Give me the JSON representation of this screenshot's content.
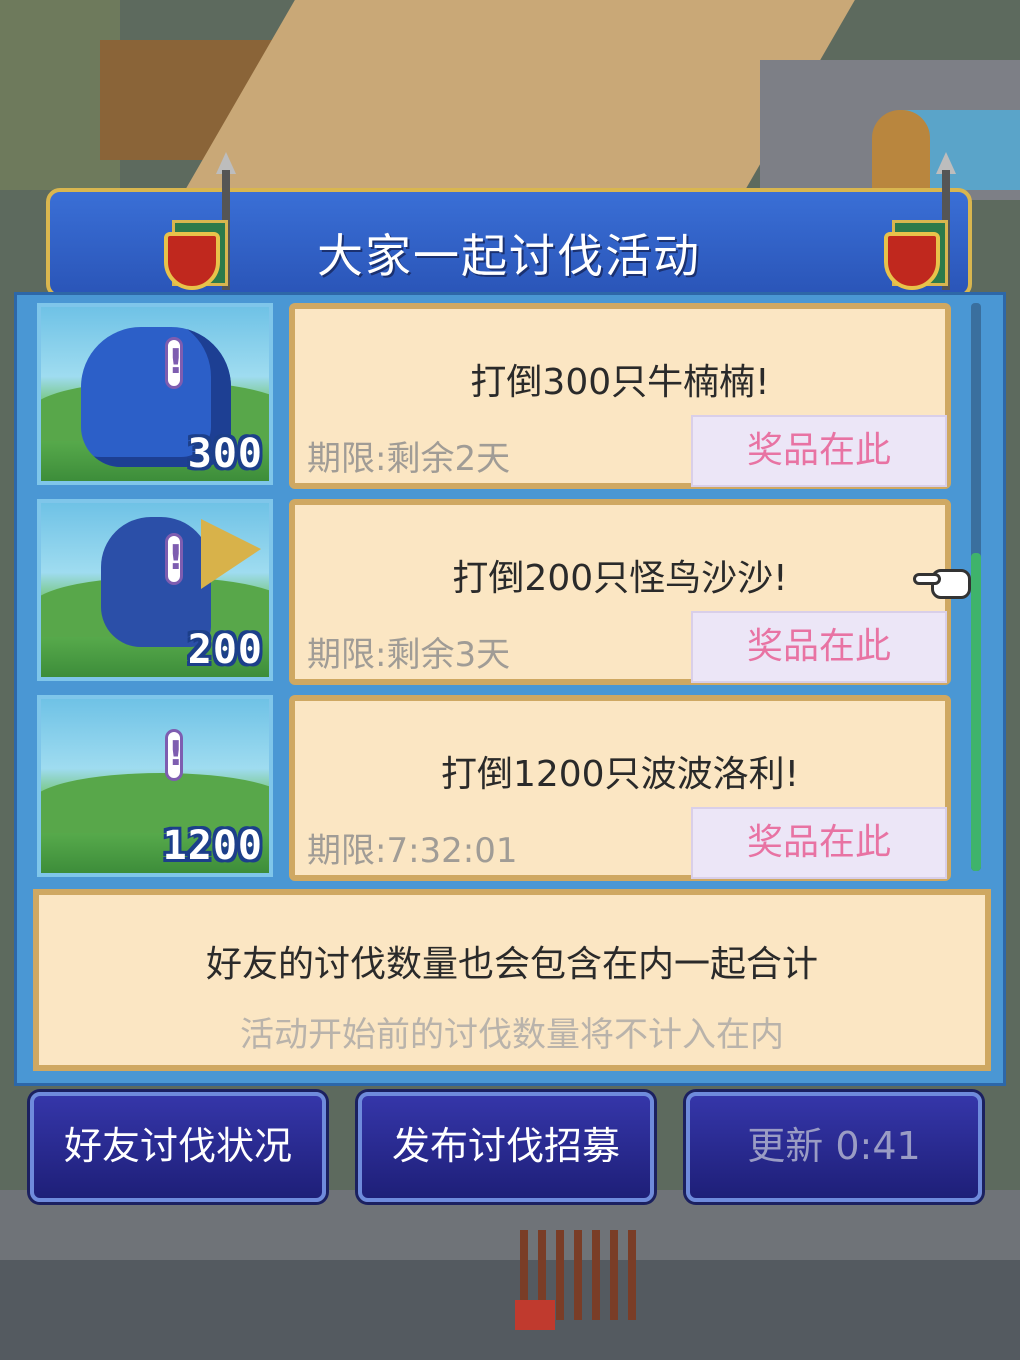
{
  "title": "大家一起讨伐活动",
  "missions": [
    {
      "mission": "打倒300只牛楠楠!",
      "deadline": "期限:剩余2天",
      "reward_label": "奖品在此",
      "count": "300"
    },
    {
      "mission": "打倒200只怪鸟沙沙!",
      "deadline": "期限:剩余3天",
      "reward_label": "奖品在此",
      "count": "200"
    },
    {
      "mission": "打倒1200只波波洛利!",
      "deadline": "期限:7:32:01",
      "reward_label": "奖品在此",
      "count": "1200"
    }
  ],
  "info": {
    "line1": "好友的讨伐数量也会包含在内一起合计",
    "line2": "活动开始前的讨伐数量将不计入在内"
  },
  "buttons": {
    "friend_status": "好友讨伐状况",
    "post_recruit": "发布讨伐招募",
    "refresh": "更新 0:41"
  },
  "colors": {
    "title_bar": "#2f60c8",
    "card": "#fbe6c3",
    "reward_text": "#e873a3",
    "button": "#2a2b93"
  }
}
